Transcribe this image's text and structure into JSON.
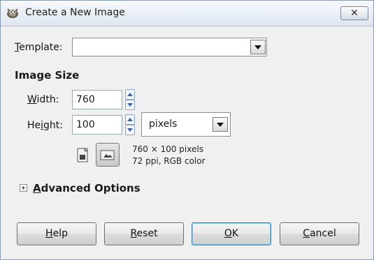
{
  "window": {
    "title": "Create a New Image",
    "close_label": "✕"
  },
  "template": {
    "label_mnemonic": "T",
    "label_rest": "emplate:",
    "value": ""
  },
  "image_size": {
    "section_title": "Image Size",
    "width_label_mnemonic": "W",
    "width_label_rest": "idth:",
    "width_value": "760",
    "height_label_pre": "He",
    "height_label_mnemonic": "i",
    "height_label_rest": "ght:",
    "height_value": "100",
    "unit_value": "pixels",
    "info_dimensions": "760 × 100 pixels",
    "info_resolution": "72 ppi, RGB color"
  },
  "advanced": {
    "label_mnemonic": "A",
    "label_rest": "dvanced Options"
  },
  "buttons": {
    "help_mnemonic": "H",
    "help_rest": "elp",
    "reset_mnemonic": "R",
    "reset_rest": "eset",
    "ok_mnemonic": "O",
    "ok_rest": "K",
    "cancel_mnemonic": "C",
    "cancel_rest": "ancel"
  },
  "icons": [
    "gimp-app-icon",
    "close-icon",
    "dropdown-arrow-icon",
    "spin-up-icon",
    "spin-down-icon",
    "portrait-icon",
    "landscape-icon",
    "expander-plus-icon"
  ]
}
